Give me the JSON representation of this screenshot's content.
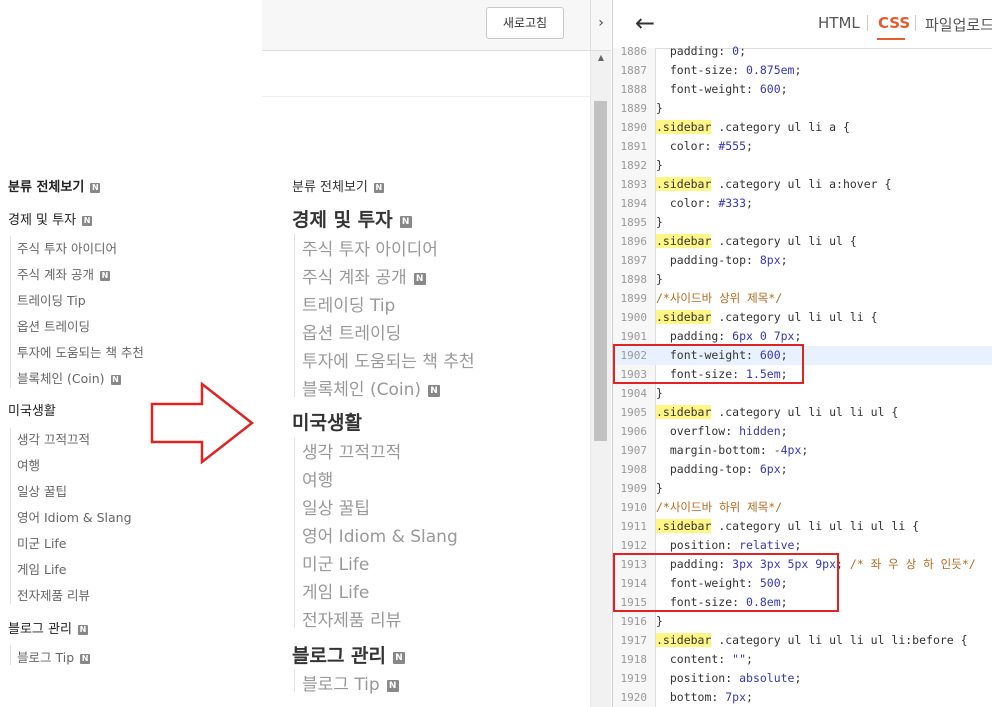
{
  "left_sidebar": {
    "view_all": "분류 전체보기",
    "groups": [
      {
        "title": "경제 및 투자",
        "items": [
          "주식 투자 아이디어",
          "주식 계좌 공개",
          "트레이딩 Tip",
          "옵션 트레이딩",
          "투자에 도움되는 책 추천",
          "블록체인 (Coin)"
        ]
      },
      {
        "title": "미국생활",
        "items": [
          "생각 끄적끄적",
          "여행",
          "일상 꿀팁",
          "영어 Idiom & Slang",
          "미군 Life",
          "게임 Life",
          "전자제품 리뷰"
        ]
      },
      {
        "title": "블로그 관리",
        "items": [
          "블로그 Tip"
        ]
      }
    ],
    "new_badge": "N"
  },
  "preview": {
    "refresh_label": "새로고침",
    "collapse_icon": "›",
    "view_all": "분류 전체보기",
    "groups": [
      {
        "title": "경제 및 투자",
        "items": [
          "주식 투자 아이디어",
          "주식 계좌 공개",
          "트레이딩 Tip",
          "옵션 트레이딩",
          "투자에 도움되는 책 추천",
          "블록체인 (Coin)"
        ]
      },
      {
        "title": "미국생활",
        "items": [
          "생각 끄적끄적",
          "여행",
          "일상 꿀팁",
          "영어 Idiom & Slang",
          "미군 Life",
          "게임 Life",
          "전자제품 리뷰"
        ]
      },
      {
        "title": "블로그 관리",
        "items": [
          "블로그 Tip"
        ]
      }
    ]
  },
  "editor": {
    "back_icon": "←",
    "tabs": [
      {
        "label": "HTML"
      },
      {
        "label": "CSS"
      },
      {
        "label": "파일업로드"
      }
    ],
    "active_tab": "CSS",
    "lines": [
      {
        "n": "1886",
        "text": "  padding: 0;"
      },
      {
        "n": "1887",
        "text": "  font-size: 0.875em;"
      },
      {
        "n": "1888",
        "text": "  font-weight: 600;"
      },
      {
        "n": "1889",
        "text": "}"
      },
      {
        "n": "1890",
        "text": ".sidebar .category ul li a {"
      },
      {
        "n": "1891",
        "text": "  color: #555;"
      },
      {
        "n": "1892",
        "text": "}"
      },
      {
        "n": "1893",
        "text": ".sidebar .category ul li a:hover {"
      },
      {
        "n": "1894",
        "text": "  color: #333;"
      },
      {
        "n": "1895",
        "text": "}"
      },
      {
        "n": "1896",
        "text": ".sidebar .category ul li ul {"
      },
      {
        "n": "1897",
        "text": "  padding-top: 8px;"
      },
      {
        "n": "1898",
        "text": "}"
      },
      {
        "n": "1899",
        "text": "/*사이드바 상위 제목*/"
      },
      {
        "n": "1900",
        "text": ".sidebar .category ul li ul li {"
      },
      {
        "n": "1901",
        "text": "  padding: 6px 0 7px;"
      },
      {
        "n": "1902",
        "text": "  font-weight: 600;"
      },
      {
        "n": "1903",
        "text": "  font-size: 1.5em;"
      },
      {
        "n": "1904",
        "text": "}"
      },
      {
        "n": "1905",
        "text": ".sidebar .category ul li ul li ul {"
      },
      {
        "n": "1906",
        "text": "  overflow: hidden;"
      },
      {
        "n": "1907",
        "text": "  margin-bottom: -4px;"
      },
      {
        "n": "1908",
        "text": "  padding-top: 6px;"
      },
      {
        "n": "1909",
        "text": "}"
      },
      {
        "n": "1910",
        "text": "/*사이드바 하위 제목*/"
      },
      {
        "n": "1911",
        "text": ".sidebar .category ul li ul li ul li {"
      },
      {
        "n": "1912",
        "text": "  position: relative;"
      },
      {
        "n": "1913",
        "text": "  padding: 3px 3px 5px 9px; /* 좌 우 상 하 인듯*/"
      },
      {
        "n": "1914",
        "text": "  font-weight: 500;"
      },
      {
        "n": "1915",
        "text": "  font-size: 0.8em;"
      },
      {
        "n": "1916",
        "text": "}"
      },
      {
        "n": "1917",
        "text": ".sidebar .category ul li ul li ul li:before {"
      },
      {
        "n": "1918",
        "text": "  content: \"\";"
      },
      {
        "n": "1919",
        "text": "  position: absolute;"
      },
      {
        "n": "1920",
        "text": "  bottom: 7px;"
      }
    ]
  },
  "colors": {
    "accent": "#e45c2d",
    "annotation": "#e02424",
    "selector_highlight": "#fff685"
  }
}
